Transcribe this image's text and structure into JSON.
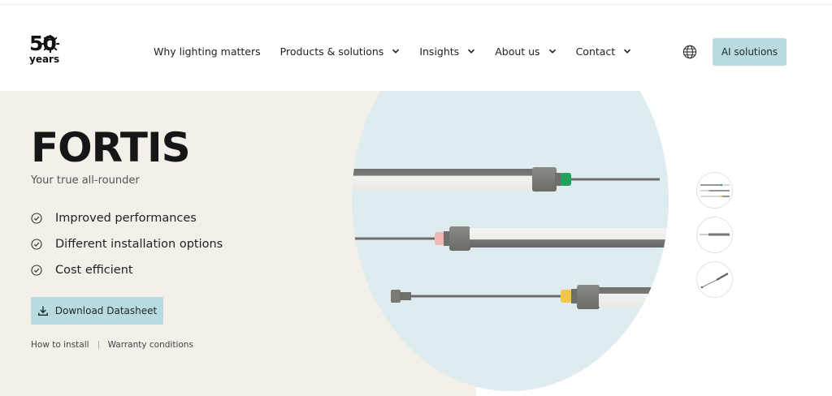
{
  "logo": {
    "number": "50",
    "word": "years"
  },
  "nav": {
    "items": [
      {
        "label": "Why lighting matters",
        "dropdown": false
      },
      {
        "label": "Products & solutions",
        "dropdown": true
      },
      {
        "label": "Insights",
        "dropdown": true
      },
      {
        "label": "About us",
        "dropdown": true
      },
      {
        "label": "Contact",
        "dropdown": true
      }
    ],
    "globe_icon": "globe-icon",
    "cta_label": "AI solutions"
  },
  "hero": {
    "title": "FORTIS",
    "subtitle": "Your true all-rounder",
    "features": [
      "Improved performances",
      "Different installation options",
      "Cost efficient"
    ],
    "download_label": "Download Datasheet",
    "links": [
      "How to install",
      "Warranty conditions"
    ]
  },
  "colors": {
    "accent": "#b9dbe0",
    "hero_bg": "#f3f0ea",
    "circle_bg": "#deecf0",
    "connector_green": "#1fa35a",
    "connector_pink": "#f2b7b0",
    "connector_yellow": "#f2c64b"
  }
}
